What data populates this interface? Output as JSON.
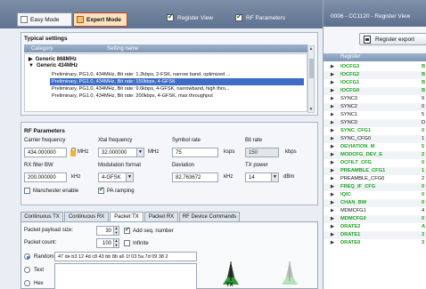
{
  "header": {
    "easy_mode": "Easy Mode",
    "expert_mode": "Expert Mode",
    "register_view": "Register View",
    "rf_parameters": "RF Parameters"
  },
  "typical": {
    "title": "Typical settings",
    "col_category": "Category",
    "col_setting": "Setting name",
    "nodes": [
      "Generic 868MHz",
      "Generic 434MHz"
    ],
    "rows": [
      "Preliminary, PG1.0, 434MHz, Bit rate: 1.2kbps, 2-FSK, narrow band, optimized ...",
      "Preliminary, PG1.0, 434MHz, Bit rate: 150kbps, 4-GFSK",
      "Preliminary, PG1.0, 434MHz, Bit rate: 9.6kbps, 4-GFSK, narrowband, high thro...",
      "Preliminary, PG1.0, 434MHz, Bit rate: 200kbps, 4-GFSK, max throughput"
    ],
    "selected_index": 1
  },
  "rf": {
    "title": "RF Parameters",
    "carrier_label": "Carrier frequency",
    "carrier_value": "434.000000",
    "carrier_unit": "MHz",
    "xtal_label": "Xtal frequency",
    "xtal_value": "32.000000",
    "xtal_unit": "MHz",
    "symbol_label": "Symbol rate",
    "symbol_value": "75",
    "symbol_unit": "ksps",
    "bitrate_label": "Bit rate",
    "bitrate_value": "150",
    "bitrate_unit": "kbps",
    "rxbw_label": "RX filter BW",
    "rxbw_value": "200.000000",
    "rxbw_unit": "kHz",
    "modulation_label": "Modulation format",
    "modulation_value": "4-GFSK",
    "deviation_label": "Deviation",
    "deviation_value": "82.763672",
    "deviation_unit": "kHz",
    "txpower_label": "TX power",
    "txpower_value": "14",
    "txpower_unit": "dBm",
    "manchester_label": "Manchester enable",
    "pa_ramping_label": "PA ramping"
  },
  "tabs": [
    "Continuous TX",
    "Continuous RX",
    "Packet TX",
    "Packet RX",
    "RF Device Commands"
  ],
  "packet": {
    "payload_label": "Packet payload size:",
    "payload_value": "30",
    "add_seq_label": "Add seq. number",
    "count_label": "Packet count:",
    "count_value": "100",
    "infinite_label": "Infinite",
    "random_label": "Random",
    "random_value": "47 de b3 12 4d c8 43 bb 8b a6 1f 03 5a 7d 09 38 2",
    "text_label": "Text",
    "hex_label": "Hex",
    "tx_label": "TX"
  },
  "right": {
    "title": "0006 - CC1120 - Register View",
    "export_label": "Register export",
    "col_register": "Register",
    "registers": [
      {
        "name": "IOCFG3",
        "value": "B",
        "changed": true
      },
      {
        "name": "IOCFG2",
        "value": "B",
        "changed": true
      },
      {
        "name": "IOCFG1",
        "value": "B",
        "changed": true
      },
      {
        "name": "IOCFG0",
        "value": "B",
        "changed": true
      },
      {
        "name": "SYNC3",
        "value": "9",
        "changed": false
      },
      {
        "name": "SYNC2",
        "value": "0",
        "changed": false
      },
      {
        "name": "SYNC1",
        "value": "5",
        "changed": false
      },
      {
        "name": "SYNC0",
        "value": "D",
        "changed": false
      },
      {
        "name": "SYNC_CFG1",
        "value": "0",
        "changed": true
      },
      {
        "name": "SYNC_CFG0",
        "value": "1",
        "changed": false
      },
      {
        "name": "DEVIATION_M",
        "value": "5",
        "changed": true
      },
      {
        "name": "MODCFG_DEV_E",
        "value": "2",
        "changed": true
      },
      {
        "name": "DCFILT_CFG",
        "value": "0",
        "changed": true
      },
      {
        "name": "PREAMBLE_CFG1",
        "value": "1",
        "changed": true
      },
      {
        "name": "PREAMBLE_CFG0",
        "value": "2",
        "changed": false
      },
      {
        "name": "FREQ_IF_CFG",
        "value": "0",
        "changed": true
      },
      {
        "name": "IQIC",
        "value": "0",
        "changed": true
      },
      {
        "name": "CHAN_BW",
        "value": "0",
        "changed": true
      },
      {
        "name": "MDMCFG1",
        "value": "4",
        "changed": false
      },
      {
        "name": "MDMCFG0",
        "value": "0",
        "changed": true
      },
      {
        "name": "DRATE2",
        "value": "A",
        "changed": true
      },
      {
        "name": "DRATE1",
        "value": "3",
        "changed": true
      },
      {
        "name": "DRATE0",
        "value": "3",
        "changed": true
      }
    ]
  },
  "colors": {
    "accent_selected": "#3d6ec4",
    "changed_register": "#1aa31a",
    "expert_tab_border": "#c8452e"
  }
}
